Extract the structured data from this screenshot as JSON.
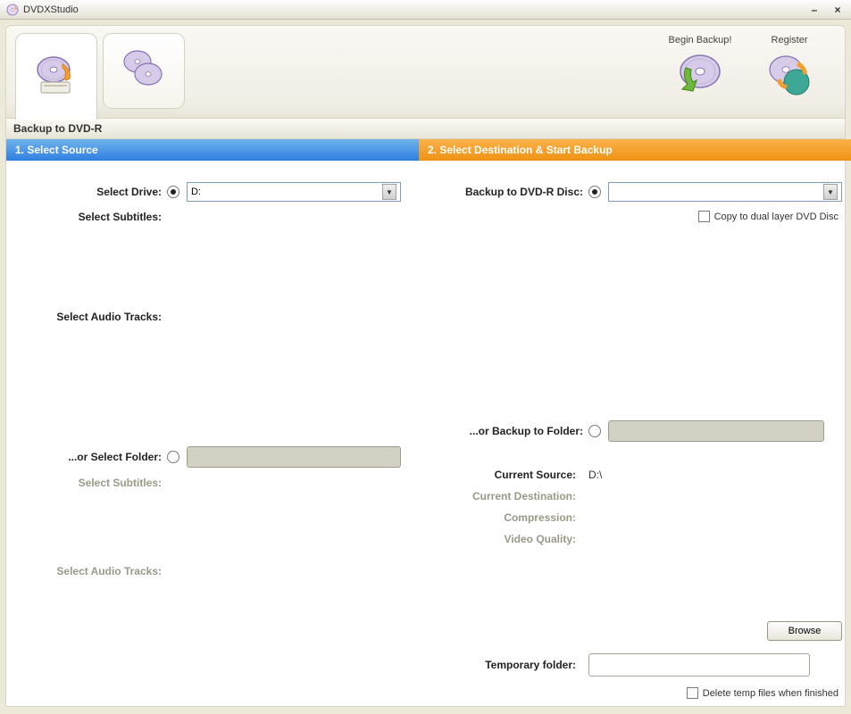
{
  "window": {
    "title": "DVDXStudio"
  },
  "toolbar": {
    "begin_backup": "Begin Backup!",
    "register": "Register"
  },
  "section_header": "Backup to DVD-R",
  "left": {
    "header": "1. Select Source",
    "select_drive": "Select Drive:",
    "drive_value": "D:",
    "select_subtitles": "Select Subtitles:",
    "select_audio": "Select Audio Tracks:",
    "or_select_folder": "...or Select Folder:",
    "select_subtitles2": "Select Subtitles:",
    "select_audio2": "Select Audio Tracks:"
  },
  "right": {
    "header": "2. Select Destination & Start Backup",
    "backup_disc": "Backup to DVD-R Disc:",
    "dual_layer": "Copy to dual layer DVD Disc",
    "or_backup_folder": "...or Backup to Folder:",
    "current_source_lbl": "Current Source:",
    "current_source_val": "D:\\",
    "current_destination_lbl": "Current Destination:",
    "compression_lbl": "Compression:",
    "video_quality_lbl": "Video Quality:",
    "browse": "Browse",
    "temp_folder": "Temporary folder:",
    "delete_temp": "Delete temp files when finished"
  }
}
